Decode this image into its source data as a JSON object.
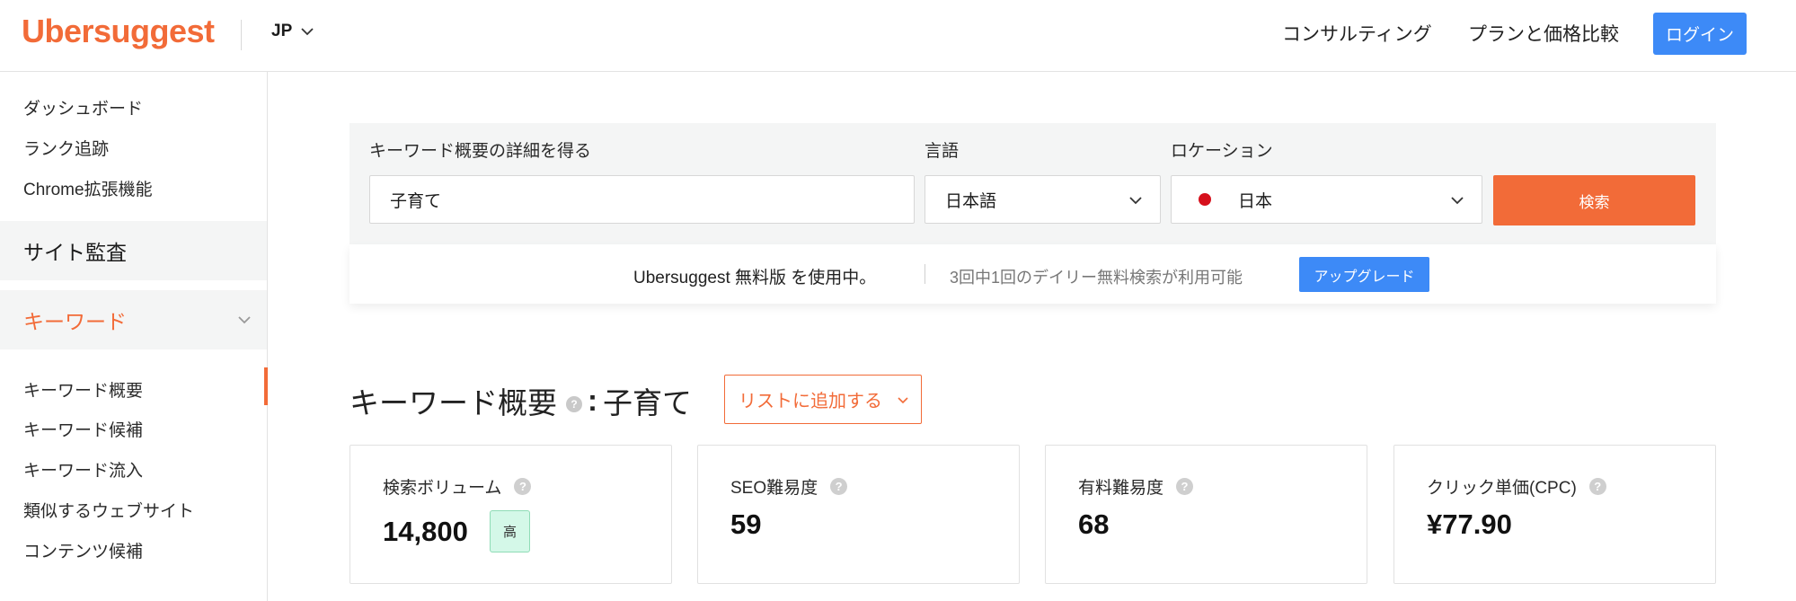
{
  "header": {
    "logo": "Ubersuggest",
    "lang": "JP",
    "nav": [
      "コンサルティング",
      "プランと価格比較"
    ],
    "login": "ログイン"
  },
  "sidebar": {
    "top_items": [
      "ダッシュボード",
      "ランク追跡",
      "Chrome拡張機能"
    ],
    "site_audit": "サイト監査",
    "keyword_section": "キーワード",
    "keyword_items": [
      "キーワード概要",
      "キーワード候補",
      "キーワード流入",
      "類似するウェブサイト",
      "コンテンツ候補"
    ],
    "active_item": "キーワード概要"
  },
  "search": {
    "keyword_label": "キーワード概要の詳細を得る",
    "keyword_value": "子育て",
    "language_label": "言語",
    "language_value": "日本語",
    "location_label": "ロケーション",
    "location_value": "日本",
    "search_button": "検索"
  },
  "banner": {
    "free_text": "Ubersuggest 無料版 を使用中。",
    "quota_text": "3回中1回のデイリー無料検索が利用可能",
    "upgrade_button": "アップグレード"
  },
  "overview": {
    "title": "キーワード概要",
    "colon": ":",
    "keyword": "子育て",
    "add_to_list": "リストに追加する"
  },
  "metrics": [
    {
      "label": "検索ボリューム",
      "value": "14,800",
      "badge": "高"
    },
    {
      "label": "SEO難易度",
      "value": "59"
    },
    {
      "label": "有料難易度",
      "value": "68"
    },
    {
      "label": "クリック単価(CPC)",
      "value": "¥77.90"
    }
  ],
  "colors": {
    "brand": "#f26b38",
    "primary_blue": "#3d8af7",
    "flag_red": "#d6101c"
  }
}
